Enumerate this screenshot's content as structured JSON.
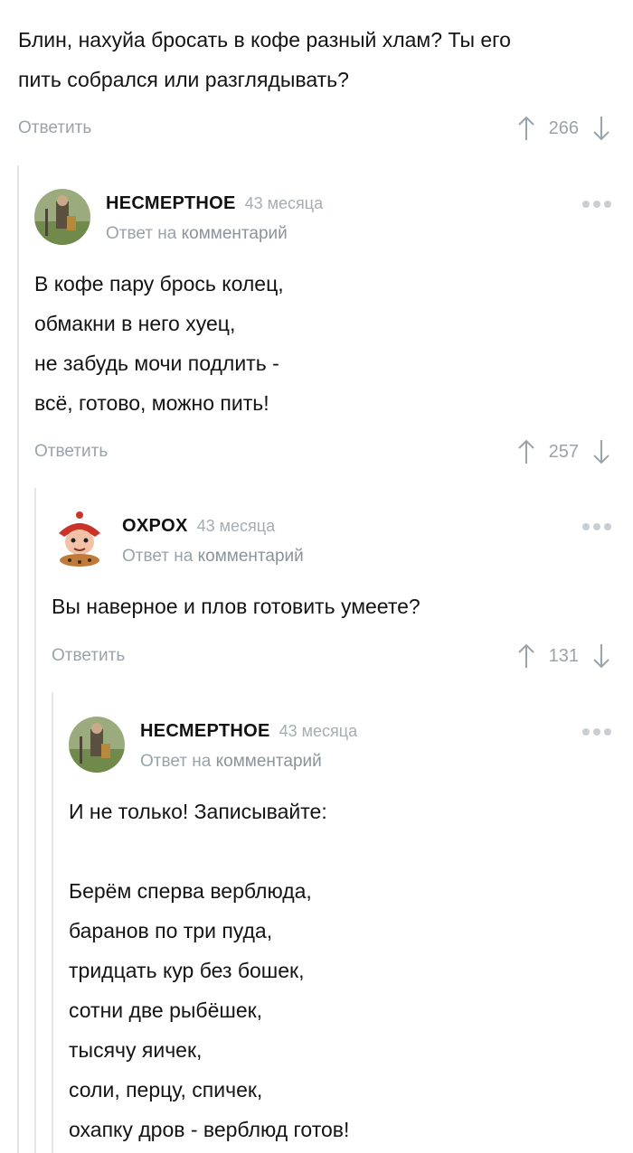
{
  "top_comment": {
    "text_line1": "Блин, нахуйа бросать в кофе разный хлам? Ты его",
    "text_line2": "пить собрался или разглядывать?",
    "reply_label": "Ответить",
    "score": "266"
  },
  "comment1": {
    "author": "НЕСМЕРТНОЕ",
    "time": "43 месяца",
    "reply_to_prefix": "Ответ на",
    "reply_to_link": "комментарий",
    "lines": [
      "В кофе пару брось колец,",
      "обмакни в него хуец,",
      "не забудь мочи подлить -",
      "всё, готово, можно пить!"
    ],
    "reply_label": "Ответить",
    "score": "257"
  },
  "comment2": {
    "author": "OXPOX",
    "time": "43 месяца",
    "reply_to_prefix": "Ответ на",
    "reply_to_link": "комментарий",
    "text": "Вы наверное и плов готовить умеете?",
    "reply_label": "Ответить",
    "score": "131"
  },
  "comment3": {
    "author": "НЕСМЕРТНОЕ",
    "time": "43 месяца",
    "reply_to_prefix": "Ответ на",
    "reply_to_link": "комментарий",
    "intro": "И не только! Записывайте:",
    "lines": [
      "Берём сперва верблюда,",
      "баранов по три пуда,",
      "тридцать кур без бошек,",
      "сотни две рыбёшек,",
      "тысячу яичек,",
      "соли, перцу, спичек,",
      "охапку дров - верблюд готов!"
    ]
  },
  "colors": {
    "muted": "#9aa3aa",
    "thread_line": "#e3e6e8",
    "text": "#141414"
  },
  "icons": {
    "upvote": "arrow-up-icon",
    "downvote": "arrow-down-icon",
    "more": "more-dots-icon"
  }
}
